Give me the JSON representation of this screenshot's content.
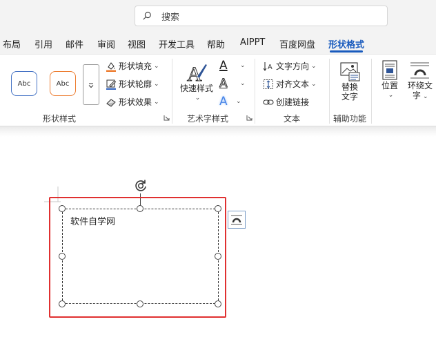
{
  "search": {
    "placeholder": "搜索"
  },
  "tabs": [
    {
      "label": "布局"
    },
    {
      "label": "引用"
    },
    {
      "label": "邮件"
    },
    {
      "label": "审阅"
    },
    {
      "label": "视图"
    },
    {
      "label": "开发工具"
    },
    {
      "label": "帮助"
    },
    {
      "label": "AIPPT"
    },
    {
      "label": "百度网盘"
    },
    {
      "label": "形状格式"
    }
  ],
  "ribbon": {
    "shape_styles": {
      "style1": "Abc",
      "style2": "Abc",
      "fill": "形状填充",
      "outline": "形状轮廓",
      "effect": "形状效果",
      "label": "形状样式"
    },
    "wordart": {
      "quick_styles": "快速样式",
      "label": "艺术字样式",
      "text_fill_glyph": "A",
      "text_outline_glyph": "A",
      "text_effect_glyph": "A"
    },
    "text": {
      "direction": "文字方向",
      "align": "对齐文本",
      "link": "创建链接",
      "label": "文本"
    },
    "accessibility": {
      "alt_text_line1": "替换",
      "alt_text_line2": "文字",
      "label": "辅助功能"
    },
    "arrange": {
      "position": "位置",
      "wrap_line1": "环绕文",
      "wrap_line2": "字"
    }
  },
  "document": {
    "textbox_text": "软件自学网"
  },
  "colors": {
    "accent": "#185abd",
    "highlight_border": "#e03030",
    "shape_fill_bar": "#ed7d31",
    "outline_bar": "#4472c4"
  }
}
